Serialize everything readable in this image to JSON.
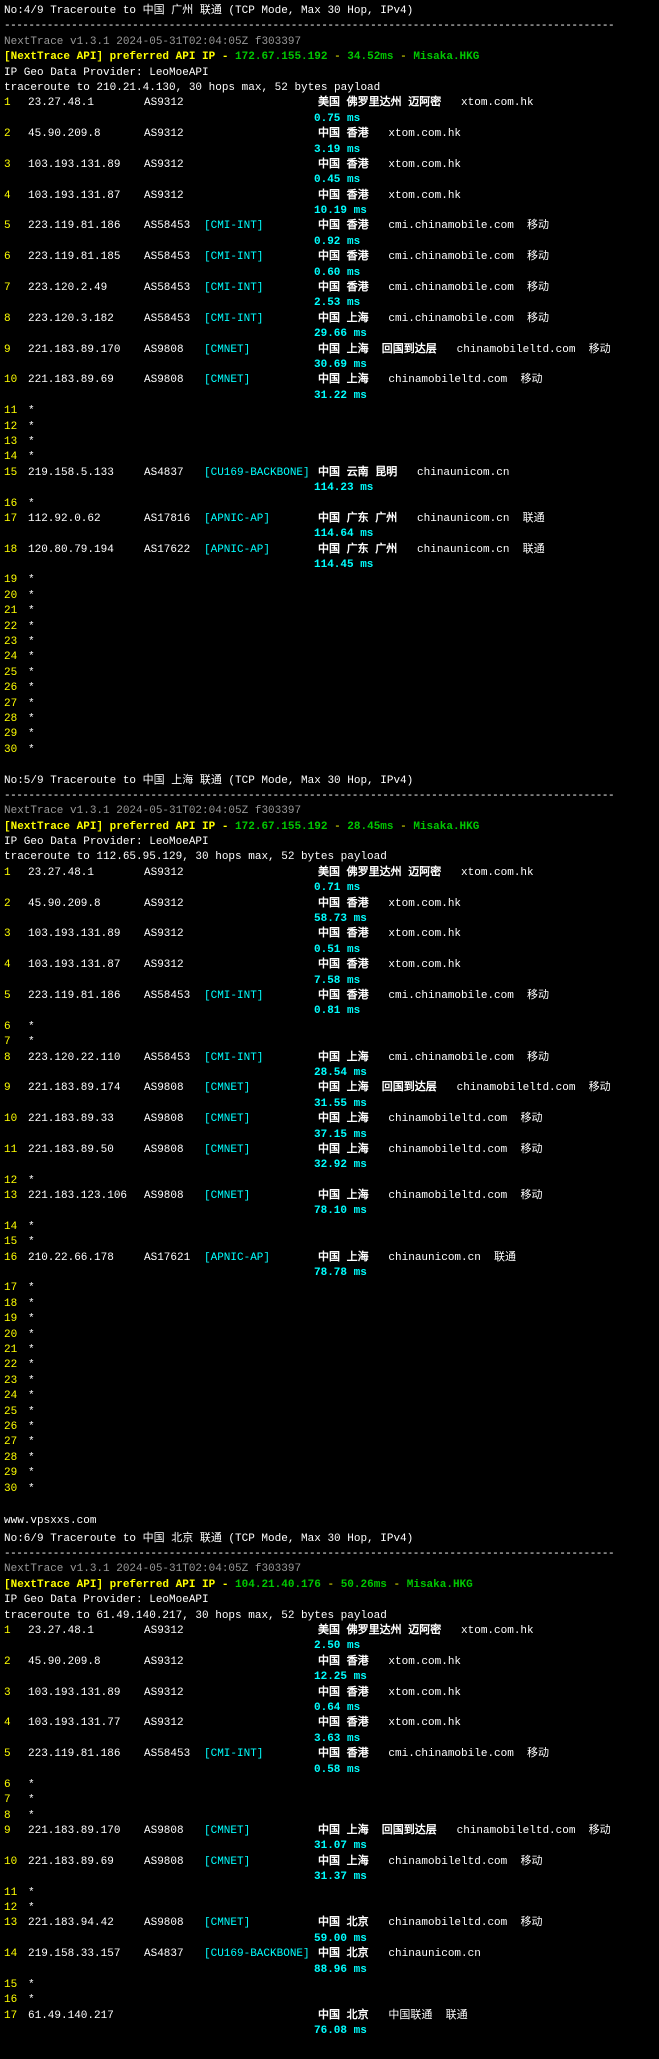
{
  "sections": [
    {
      "header": {
        "title": "No:4/9 Traceroute to 中国 广州 联通 (TCP Mode, Max 30 Hop, IPv4)",
        "nexttrace_ver": "NextTrace v1.3.1 2024-05-31T02:04:05Z f303397",
        "api_line": "[NextTrace API] preferred API IP -",
        "api_ip": "172.67.155.192",
        "api_latency": "34.52ms",
        "api_loc": "Misaka.HKG",
        "geo_provider": "IP Geo Data Provider: LeoMoeAPI",
        "trace_target": "traceroute to 210.21.4.130, 30 hops max, 52 bytes payload"
      },
      "hops": [
        {
          "n": "1",
          "ip": "23.27.48.1",
          "asn": "AS9312",
          "net": "",
          "loc": "美国 佛罗里达州 迈阿密",
          "host": "xtom.com.hk",
          "ms": "0.75 ms"
        },
        {
          "n": "2",
          "ip": "45.90.209.8",
          "asn": "AS9312",
          "net": "",
          "loc": "中国 香港",
          "host": "xtom.com.hk",
          "ms": "3.19 ms"
        },
        {
          "n": "3",
          "ip": "103.193.131.89",
          "asn": "AS9312",
          "net": "",
          "loc": "中国 香港",
          "host": "xtom.com.hk",
          "ms": "0.45 ms"
        },
        {
          "n": "4",
          "ip": "103.193.131.87",
          "asn": "AS9312",
          "net": "",
          "loc": "中国 香港",
          "host": "xtom.com.hk",
          "ms": "10.19 ms"
        },
        {
          "n": "5",
          "ip": "223.119.81.186",
          "asn": "AS58453",
          "net": "[CMI-INT]",
          "loc": "中国 香港",
          "host": "cmi.chinamobile.com  移动",
          "ms": "0.92 ms"
        },
        {
          "n": "6",
          "ip": "223.119.81.185",
          "asn": "AS58453",
          "net": "[CMI-INT]",
          "loc": "中国 香港",
          "host": "cmi.chinamobile.com  移动",
          "ms": "0.60 ms"
        },
        {
          "n": "7",
          "ip": "223.120.2.49",
          "asn": "AS58453",
          "net": "[CMI-INT]",
          "loc": "中国 香港",
          "host": "cmi.chinamobile.com  移动",
          "ms": "2.53 ms"
        },
        {
          "n": "8",
          "ip": "223.120.3.182",
          "asn": "AS58453",
          "net": "[CMI-INT]",
          "loc": "中国 上海",
          "host": "cmi.chinamobile.com  移动",
          "ms": "29.66 ms"
        },
        {
          "n": "9",
          "ip": "221.183.89.170",
          "asn": "AS9808",
          "net": "[CMNET]",
          "loc": "中国 上海  回国到达层",
          "host": "chinamobileltd.com  移动",
          "ms": "30.69 ms"
        },
        {
          "n": "10",
          "ip": "221.183.89.69",
          "asn": "AS9808",
          "net": "[CMNET]",
          "loc": "中国 上海",
          "host": "chinamobileltd.com  移动",
          "ms": "31.22 ms"
        },
        {
          "n": "11",
          "star": true
        },
        {
          "n": "12",
          "star": true
        },
        {
          "n": "13",
          "star": true
        },
        {
          "n": "14",
          "star": true
        },
        {
          "n": "15",
          "ip": "219.158.5.133",
          "asn": "AS4837",
          "net": "[CU169-BACKBONE]",
          "loc": "中国 云南 昆明",
          "host": "chinaunicom.cn",
          "ms": "114.23 ms"
        },
        {
          "n": "16",
          "star": true
        },
        {
          "n": "17",
          "ip": "112.92.0.62",
          "asn": "AS17816",
          "net": "[APNIC-AP]",
          "loc": "中国 广东 广州",
          "host": "chinaunicom.cn  联通",
          "ms": "114.64 ms"
        },
        {
          "n": "18",
          "ip": "120.80.79.194",
          "asn": "AS17622",
          "net": "[APNIC-AP]",
          "loc": "中国 广东 广州",
          "host": "chinaunicom.cn  联通",
          "ms": "114.45 ms"
        },
        {
          "n": "19",
          "star": true
        },
        {
          "n": "20",
          "star": true
        },
        {
          "n": "21",
          "star": true
        },
        {
          "n": "22",
          "star": true
        },
        {
          "n": "23",
          "star": true
        },
        {
          "n": "24",
          "star": true
        },
        {
          "n": "25",
          "star": true
        },
        {
          "n": "26",
          "star": true
        },
        {
          "n": "27",
          "star": true
        },
        {
          "n": "28",
          "star": true
        },
        {
          "n": "29",
          "star": true
        },
        {
          "n": "30",
          "star": true
        }
      ]
    },
    {
      "header": {
        "title": "No:5/9 Traceroute to 中国 上海 联通 (TCP Mode, Max 30 Hop, IPv4)",
        "nexttrace_ver": "NextTrace v1.3.1 2024-05-31T02:04:05Z f303397",
        "api_line": "[NextTrace API] preferred API IP -",
        "api_ip": "172.67.155.192",
        "api_latency": "28.45ms",
        "api_loc": "Misaka.HKG",
        "geo_provider": "IP Geo Data Provider: LeoMoeAPI",
        "trace_target": "traceroute to 112.65.95.129, 30 hops max, 52 bytes payload"
      },
      "hops": [
        {
          "n": "1",
          "ip": "23.27.48.1",
          "asn": "AS9312",
          "net": "",
          "loc": "美国 佛罗里达州 迈阿密",
          "host": "xtom.com.hk",
          "ms": "0.71 ms"
        },
        {
          "n": "2",
          "ip": "45.90.209.8",
          "asn": "AS9312",
          "net": "",
          "loc": "中国 香港",
          "host": "xtom.com.hk",
          "ms": "58.73 ms"
        },
        {
          "n": "3",
          "ip": "103.193.131.89",
          "asn": "AS9312",
          "net": "",
          "loc": "中国 香港",
          "host": "xtom.com.hk",
          "ms": "0.51 ms"
        },
        {
          "n": "4",
          "ip": "103.193.131.87",
          "asn": "AS9312",
          "net": "",
          "loc": "中国 香港",
          "host": "xtom.com.hk",
          "ms": "7.58 ms"
        },
        {
          "n": "5",
          "ip": "223.119.81.186",
          "asn": "AS58453",
          "net": "[CMI-INT]",
          "loc": "中国 香港",
          "host": "cmi.chinamobile.com  移动",
          "ms": "0.81 ms"
        },
        {
          "n": "6",
          "star": true
        },
        {
          "n": "7",
          "star": true
        },
        {
          "n": "8",
          "ip": "223.120.22.110",
          "asn": "AS58453",
          "net": "[CMI-INT]",
          "loc": "中国 上海",
          "host": "cmi.chinamobile.com  移动",
          "ms": "28.54 ms"
        },
        {
          "n": "9",
          "ip": "221.183.89.174",
          "asn": "AS9808",
          "net": "[CMNET]",
          "loc": "中国 上海  回国到达层",
          "host": "chinamobileltd.com  移动",
          "ms": "31.55 ms"
        },
        {
          "n": "10",
          "ip": "221.183.89.33",
          "asn": "AS9808",
          "net": "[CMNET]",
          "loc": "中国 上海",
          "host": "chinamobileltd.com  移动",
          "ms": "37.15 ms"
        },
        {
          "n": "11",
          "ip": "221.183.89.50",
          "asn": "AS9808",
          "net": "[CMNET]",
          "loc": "中国 上海",
          "host": "chinamobileltd.com  移动",
          "ms": "32.92 ms"
        },
        {
          "n": "12",
          "star": true
        },
        {
          "n": "13",
          "ip": "221.183.123.106",
          "asn": "AS9808",
          "net": "[CMNET]",
          "loc": "中国 上海",
          "host": "chinamobileltd.com  移动",
          "ms": "78.10 ms"
        },
        {
          "n": "14",
          "star": true
        },
        {
          "n": "15",
          "star": true
        },
        {
          "n": "16",
          "ip": "210.22.66.178",
          "asn": "AS17621",
          "net": "[APNIC-AP]",
          "loc": "中国 上海",
          "host": "chinaunicom.cn  联通",
          "ms": "78.78 ms"
        },
        {
          "n": "17",
          "star": true
        },
        {
          "n": "18",
          "star": true
        },
        {
          "n": "19",
          "star": true
        },
        {
          "n": "20",
          "star": true
        },
        {
          "n": "21",
          "star": true
        },
        {
          "n": "22",
          "star": true
        },
        {
          "n": "23",
          "star": true
        },
        {
          "n": "24",
          "star": true
        },
        {
          "n": "25",
          "star": true
        },
        {
          "n": "26",
          "star": true
        },
        {
          "n": "27",
          "star": true
        },
        {
          "n": "28",
          "star": true
        },
        {
          "n": "29",
          "star": true
        },
        {
          "n": "30",
          "star": true
        }
      ]
    },
    {
      "watermark": "www.vpsxxs.com",
      "header": {
        "title": "No:6/9 Traceroute to 中国 北京 联通 (TCP Mode, Max 30 Hop, IPv4)",
        "nexttrace_ver": "NextTrace v1.3.1 2024-05-31T02:04:05Z f303397",
        "api_line": "[NextTrace API] preferred API IP -",
        "api_ip": "104.21.40.176",
        "api_latency": "50.26ms",
        "api_loc": "Misaka.HKG",
        "geo_provider": "IP Geo Data Provider: LeoMoeAPI",
        "trace_target": "traceroute to 61.49.140.217, 30 hops max, 52 bytes payload"
      },
      "hops": [
        {
          "n": "1",
          "ip": "23.27.48.1",
          "asn": "AS9312",
          "net": "",
          "loc": "美国 佛罗里达州 迈阿密",
          "host": "xtom.com.hk",
          "ms": "2.50 ms"
        },
        {
          "n": "2",
          "ip": "45.90.209.8",
          "asn": "AS9312",
          "net": "",
          "loc": "中国 香港",
          "host": "xtom.com.hk",
          "ms": "12.25 ms"
        },
        {
          "n": "3",
          "ip": "103.193.131.89",
          "asn": "AS9312",
          "net": "",
          "loc": "中国 香港",
          "host": "xtom.com.hk",
          "ms": "0.64 ms"
        },
        {
          "n": "4",
          "ip": "103.193.131.77",
          "asn": "AS9312",
          "net": "",
          "loc": "中国 香港",
          "host": "xtom.com.hk",
          "ms": "3.63 ms"
        },
        {
          "n": "5",
          "ip": "223.119.81.186",
          "asn": "AS58453",
          "net": "[CMI-INT]",
          "loc": "中国 香港",
          "host": "cmi.chinamobile.com  移动",
          "ms": "0.58 ms"
        },
        {
          "n": "6",
          "star": true
        },
        {
          "n": "7",
          "star": true
        },
        {
          "n": "8",
          "star": true
        },
        {
          "n": "9",
          "ip": "221.183.89.170",
          "asn": "AS9808",
          "net": "[CMNET]",
          "loc": "中国 上海  回国到达层",
          "host": "chinamobileltd.com  移动",
          "ms": "31.07 ms"
        },
        {
          "n": "10",
          "ip": "221.183.89.69",
          "asn": "AS9808",
          "net": "[CMNET]",
          "loc": "中国 上海",
          "host": "chinamobileltd.com  移动",
          "ms": "31.37 ms"
        },
        {
          "n": "11",
          "star": true
        },
        {
          "n": "12",
          "star": true
        },
        {
          "n": "13",
          "ip": "221.183.94.42",
          "asn": "AS9808",
          "net": "[CMNET]",
          "loc": "中国 北京",
          "host": "chinamobileltd.com  移动",
          "ms": "59.00 ms"
        },
        {
          "n": "14",
          "ip": "219.158.33.157",
          "asn": "AS4837",
          "net": "[CU169-BACKBONE]",
          "loc": "中国 北京",
          "host": "chinaunicom.cn",
          "ms": "88.96 ms"
        },
        {
          "n": "15",
          "star": true
        },
        {
          "n": "16",
          "star": true
        },
        {
          "n": "17",
          "ip": "61.49.140.217",
          "asn": "",
          "net": "",
          "loc": "中国 北京",
          "host": "中国联通  联通",
          "ms": "76.08 ms"
        }
      ]
    }
  ],
  "separator": "----------------------------------------------------------------------------------------------------"
}
